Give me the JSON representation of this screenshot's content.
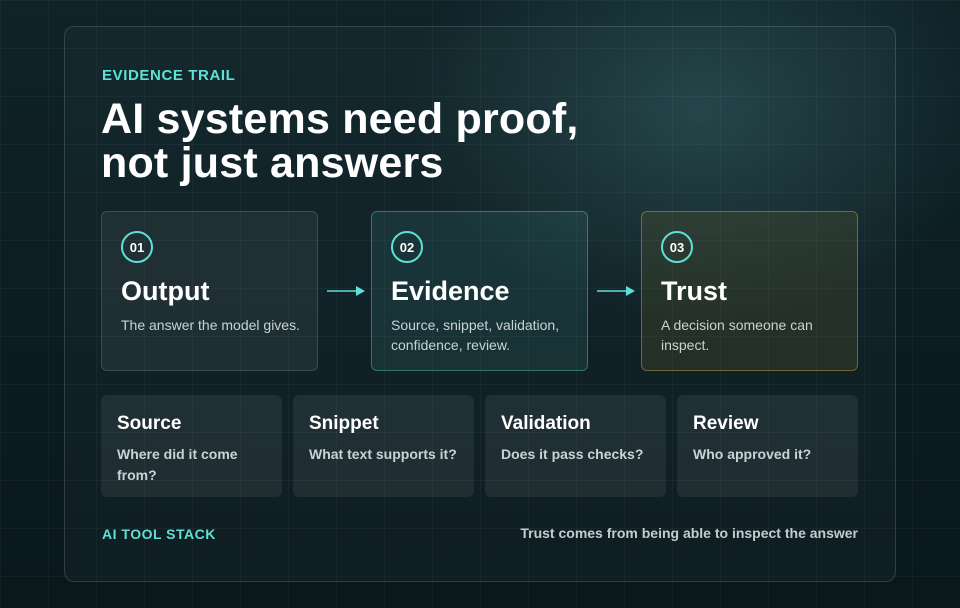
{
  "eyebrow": "EVIDENCE TRAIL",
  "title": {
    "line1": "AI systems need proof,",
    "line2": "not just answers"
  },
  "steps": [
    {
      "number": "01",
      "title": "Output",
      "description": "The answer the model gives."
    },
    {
      "number": "02",
      "title": "Evidence",
      "description": "Source, snippet, validation, confidence, review."
    },
    {
      "number": "03",
      "title": "Trust",
      "description": "A decision someone can inspect."
    }
  ],
  "cards": [
    {
      "title": "Source",
      "question": "Where did it come from?"
    },
    {
      "title": "Snippet",
      "question": "What text supports it?"
    },
    {
      "title": "Validation",
      "question": "Does it pass checks?"
    },
    {
      "title": "Review",
      "question": "Who approved it?"
    }
  ],
  "footer": {
    "left": "AI TOOL STACK",
    "right": "Trust comes from being able to inspect the answer"
  },
  "colors": {
    "accent": "#5ee0d6",
    "background": "#0b1a1f",
    "trust_border": "#c8aa46"
  },
  "icons": {
    "connector": "arrow-right-icon"
  }
}
